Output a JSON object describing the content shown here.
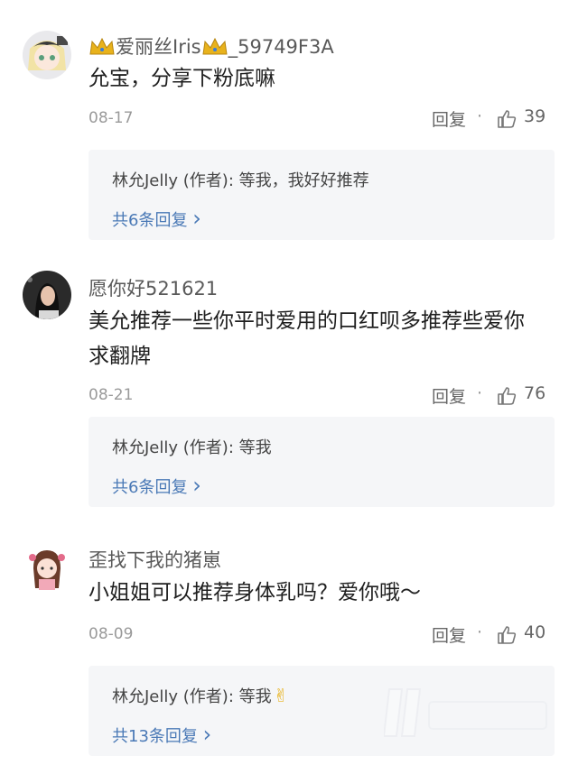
{
  "comments": [
    {
      "username_prefix": "爱丽丝Iris",
      "username_suffix": "_59749F3A",
      "text": "允宝，分享下粉底嘛",
      "date": "08-17",
      "reply_label": "回复",
      "dot": "·",
      "likes": "39",
      "author_reply_name": "林允Jelly (作者)",
      "author_reply_text": ": 等我，我好好推荐",
      "view_replies": "共6条回复",
      "chevron": "›"
    },
    {
      "username": "愿你好521621",
      "text": "美允推荐一些你平时爱用的口红呗多推荐些爱你求翻牌",
      "date": "08-21",
      "reply_label": "回复",
      "dot": "·",
      "likes": "76",
      "author_reply_name": "林允Jelly (作者)",
      "author_reply_text": ": 等我",
      "view_replies": "共6条回复",
      "chevron": "›"
    },
    {
      "username": "歪找下我的猪崽",
      "text": "小姐姐可以推荐身体乳吗？爱你哦～",
      "date": "08-09",
      "reply_label": "回复",
      "dot": "·",
      "likes": "40",
      "author_reply_name": "林允Jelly (作者)",
      "author_reply_text": ": 等我",
      "author_reply_emoji": "✌",
      "view_replies": "共13条回复",
      "chevron": "›"
    }
  ],
  "icons": {
    "like": "thumbs-up-icon",
    "crown": "crown-icon",
    "chevron": "chevron-right-icon"
  },
  "colors": {
    "link": "#4a79b6",
    "reply_bg": "#f5f6f8",
    "crown": "#e8b21c"
  }
}
